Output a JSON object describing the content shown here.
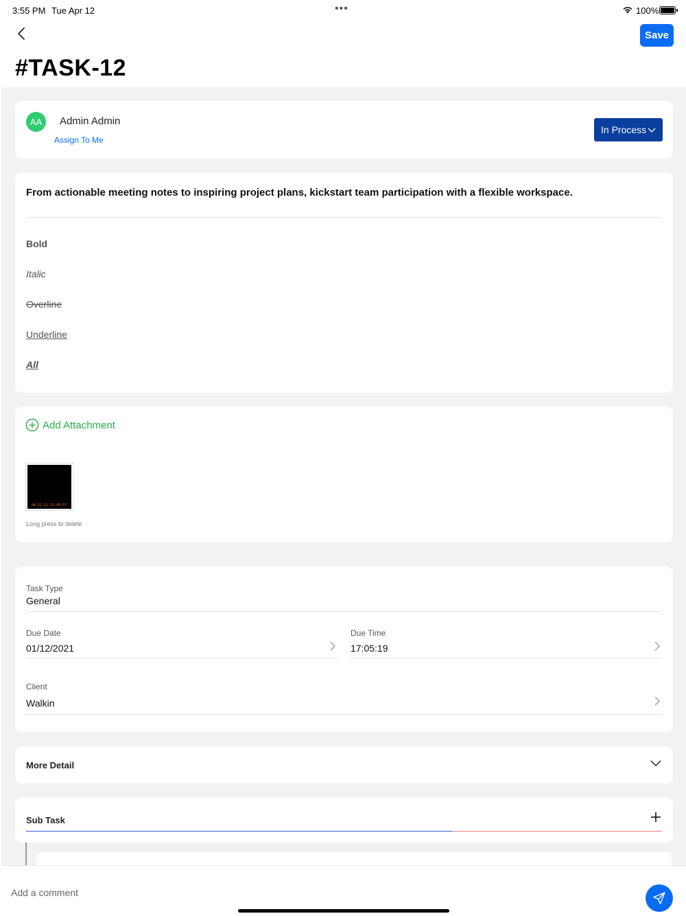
{
  "status_bar": {
    "time": "3:55 PM",
    "date": "Tue Apr 12",
    "dots": "•••",
    "battery": "100%"
  },
  "nav": {
    "back_icon": "chevron-left-icon",
    "save_label": "Save"
  },
  "title": "#TASK-12",
  "assignee": {
    "initials": "AA",
    "avatar_color": "#2ecc71",
    "name": "Admin Admin",
    "assign_link": "Assign To Me",
    "status": "In Process"
  },
  "description": {
    "headline": "From actionable meeting notes to inspiring project plans, kickstart team participation with a flexible workspace.",
    "lines": {
      "bold": "Bold",
      "italic": "Italic",
      "overline": "Overline",
      "underline": "Underline",
      "all": "All"
    }
  },
  "attachments": {
    "add_label": "Add Attachment",
    "thumbnail_stamp": "04.12.21 15:06:57",
    "hint": "Long press to delete"
  },
  "fields": {
    "task_type": {
      "label": "Task Type",
      "value": "General"
    },
    "due_date": {
      "label": "Due Date",
      "value": "01/12/2021"
    },
    "due_time": {
      "label": "Due Time",
      "value": "17:05:19"
    },
    "client": {
      "label": "Client",
      "value": "Walkin"
    }
  },
  "more_detail": {
    "label": "More Detail"
  },
  "sub_task": {
    "label": "Sub Task",
    "progress_fraction": 0.67
  },
  "comment": {
    "placeholder": "Add a comment"
  },
  "colors": {
    "accent": "#0a6cf5",
    "status_button": "#0a3fa0",
    "attachment_green": "#2eaa4a",
    "progress_done": "#2b5fc8",
    "progress_remaining": "#f07c7c"
  }
}
